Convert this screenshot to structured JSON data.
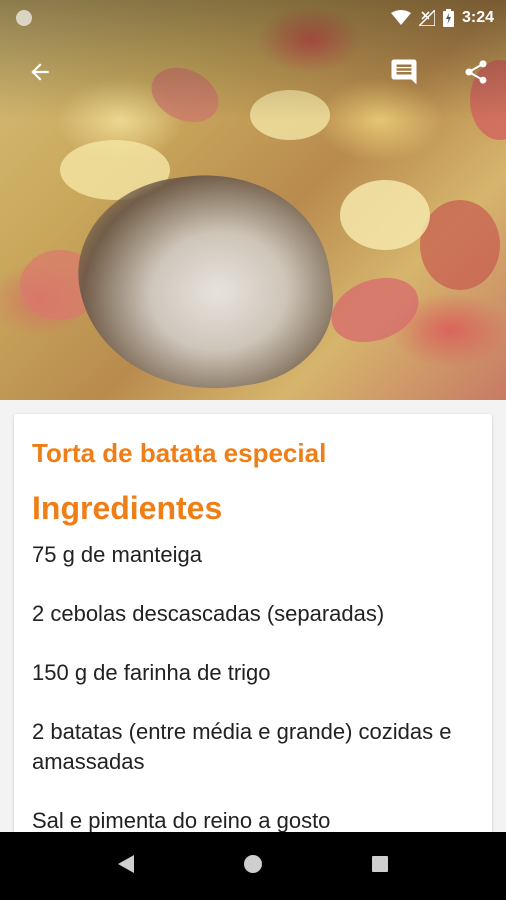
{
  "status_bar": {
    "time": "3:24",
    "icons": [
      "notification-dot-icon",
      "wifi-icon",
      "no-signal-icon",
      "battery-charging-icon"
    ]
  },
  "toolbar": {
    "icons": [
      "back-arrow-icon",
      "comment-icon",
      "share-icon"
    ]
  },
  "recipe": {
    "title": "Torta de batata especial",
    "ingredients_heading": "Ingredientes",
    "ingredients": [
      "75 g de manteiga",
      "2 cebolas descascadas (separadas)",
      "150 g de farinha de trigo",
      "2 batatas (entre média e grande) cozidas e amassadas",
      "Sal e pimenta do reino a gosto"
    ]
  },
  "nav_bar": {
    "icons": [
      "nav-back-icon",
      "nav-home-icon",
      "nav-recents-icon"
    ]
  },
  "colors": {
    "accent": "#f07e16",
    "text": "#222222",
    "background": "#f3f3f3",
    "nav_bar": "#000000"
  }
}
